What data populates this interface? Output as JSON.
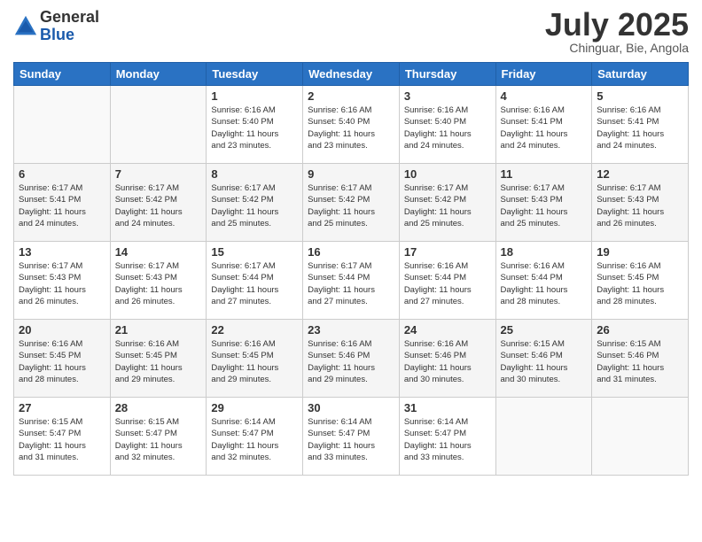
{
  "logo": {
    "general": "General",
    "blue": "Blue"
  },
  "title": "July 2025",
  "subtitle": "Chinguar, Bie, Angola",
  "headers": [
    "Sunday",
    "Monday",
    "Tuesday",
    "Wednesday",
    "Thursday",
    "Friday",
    "Saturday"
  ],
  "weeks": [
    [
      {
        "day": "",
        "info": ""
      },
      {
        "day": "",
        "info": ""
      },
      {
        "day": "1",
        "info": "Sunrise: 6:16 AM\nSunset: 5:40 PM\nDaylight: 11 hours\nand 23 minutes."
      },
      {
        "day": "2",
        "info": "Sunrise: 6:16 AM\nSunset: 5:40 PM\nDaylight: 11 hours\nand 23 minutes."
      },
      {
        "day": "3",
        "info": "Sunrise: 6:16 AM\nSunset: 5:40 PM\nDaylight: 11 hours\nand 24 minutes."
      },
      {
        "day": "4",
        "info": "Sunrise: 6:16 AM\nSunset: 5:41 PM\nDaylight: 11 hours\nand 24 minutes."
      },
      {
        "day": "5",
        "info": "Sunrise: 6:16 AM\nSunset: 5:41 PM\nDaylight: 11 hours\nand 24 minutes."
      }
    ],
    [
      {
        "day": "6",
        "info": "Sunrise: 6:17 AM\nSunset: 5:41 PM\nDaylight: 11 hours\nand 24 minutes."
      },
      {
        "day": "7",
        "info": "Sunrise: 6:17 AM\nSunset: 5:42 PM\nDaylight: 11 hours\nand 24 minutes."
      },
      {
        "day": "8",
        "info": "Sunrise: 6:17 AM\nSunset: 5:42 PM\nDaylight: 11 hours\nand 25 minutes."
      },
      {
        "day": "9",
        "info": "Sunrise: 6:17 AM\nSunset: 5:42 PM\nDaylight: 11 hours\nand 25 minutes."
      },
      {
        "day": "10",
        "info": "Sunrise: 6:17 AM\nSunset: 5:42 PM\nDaylight: 11 hours\nand 25 minutes."
      },
      {
        "day": "11",
        "info": "Sunrise: 6:17 AM\nSunset: 5:43 PM\nDaylight: 11 hours\nand 25 minutes."
      },
      {
        "day": "12",
        "info": "Sunrise: 6:17 AM\nSunset: 5:43 PM\nDaylight: 11 hours\nand 26 minutes."
      }
    ],
    [
      {
        "day": "13",
        "info": "Sunrise: 6:17 AM\nSunset: 5:43 PM\nDaylight: 11 hours\nand 26 minutes."
      },
      {
        "day": "14",
        "info": "Sunrise: 6:17 AM\nSunset: 5:43 PM\nDaylight: 11 hours\nand 26 minutes."
      },
      {
        "day": "15",
        "info": "Sunrise: 6:17 AM\nSunset: 5:44 PM\nDaylight: 11 hours\nand 27 minutes."
      },
      {
        "day": "16",
        "info": "Sunrise: 6:17 AM\nSunset: 5:44 PM\nDaylight: 11 hours\nand 27 minutes."
      },
      {
        "day": "17",
        "info": "Sunrise: 6:16 AM\nSunset: 5:44 PM\nDaylight: 11 hours\nand 27 minutes."
      },
      {
        "day": "18",
        "info": "Sunrise: 6:16 AM\nSunset: 5:44 PM\nDaylight: 11 hours\nand 28 minutes."
      },
      {
        "day": "19",
        "info": "Sunrise: 6:16 AM\nSunset: 5:45 PM\nDaylight: 11 hours\nand 28 minutes."
      }
    ],
    [
      {
        "day": "20",
        "info": "Sunrise: 6:16 AM\nSunset: 5:45 PM\nDaylight: 11 hours\nand 28 minutes."
      },
      {
        "day": "21",
        "info": "Sunrise: 6:16 AM\nSunset: 5:45 PM\nDaylight: 11 hours\nand 29 minutes."
      },
      {
        "day": "22",
        "info": "Sunrise: 6:16 AM\nSunset: 5:45 PM\nDaylight: 11 hours\nand 29 minutes."
      },
      {
        "day": "23",
        "info": "Sunrise: 6:16 AM\nSunset: 5:46 PM\nDaylight: 11 hours\nand 29 minutes."
      },
      {
        "day": "24",
        "info": "Sunrise: 6:16 AM\nSunset: 5:46 PM\nDaylight: 11 hours\nand 30 minutes."
      },
      {
        "day": "25",
        "info": "Sunrise: 6:15 AM\nSunset: 5:46 PM\nDaylight: 11 hours\nand 30 minutes."
      },
      {
        "day": "26",
        "info": "Sunrise: 6:15 AM\nSunset: 5:46 PM\nDaylight: 11 hours\nand 31 minutes."
      }
    ],
    [
      {
        "day": "27",
        "info": "Sunrise: 6:15 AM\nSunset: 5:47 PM\nDaylight: 11 hours\nand 31 minutes."
      },
      {
        "day": "28",
        "info": "Sunrise: 6:15 AM\nSunset: 5:47 PM\nDaylight: 11 hours\nand 32 minutes."
      },
      {
        "day": "29",
        "info": "Sunrise: 6:14 AM\nSunset: 5:47 PM\nDaylight: 11 hours\nand 32 minutes."
      },
      {
        "day": "30",
        "info": "Sunrise: 6:14 AM\nSunset: 5:47 PM\nDaylight: 11 hours\nand 33 minutes."
      },
      {
        "day": "31",
        "info": "Sunrise: 6:14 AM\nSunset: 5:47 PM\nDaylight: 11 hours\nand 33 minutes."
      },
      {
        "day": "",
        "info": ""
      },
      {
        "day": "",
        "info": ""
      }
    ]
  ]
}
